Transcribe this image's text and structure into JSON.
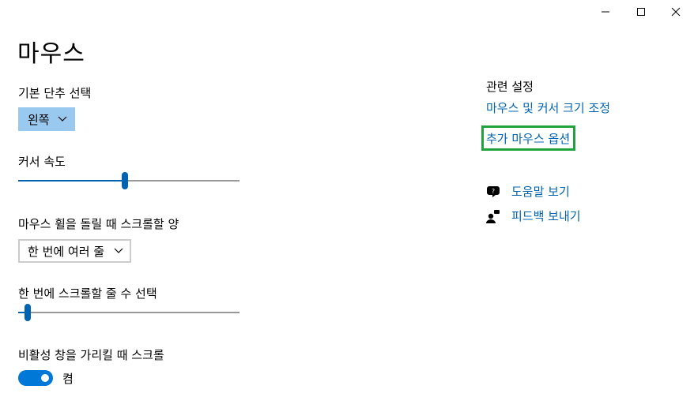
{
  "window": {
    "minimize_icon": "minimize-icon",
    "maximize_icon": "maximize-icon",
    "close_icon": "close-icon"
  },
  "page": {
    "title": "마우스"
  },
  "primary_button": {
    "label": "기본 단추 선택",
    "value": "왼쪽"
  },
  "cursor_speed": {
    "label": "커서 속도",
    "level": 0.48
  },
  "wheel_scroll": {
    "label": "마우스 휠을 돌릴 때 스크롤할 양",
    "value": "한 번에 여러 줄"
  },
  "lines_to_scroll": {
    "label": "한 번에 스크롤할 줄 수 선택",
    "level": 0.03
  },
  "inactive_scroll": {
    "label": "비활성 창을 가리킬 때 스크롤",
    "state": "켬",
    "on": true
  },
  "related": {
    "heading": "관련 설정",
    "links": [
      "마우스 및 커서 크기 조정",
      "추가 마우스 옵션"
    ]
  },
  "help": {
    "get_help": "도움말 보기",
    "feedback": "피드백 보내기"
  },
  "colors": {
    "accent": "#0063b1",
    "toggle_on": "#0078d7",
    "combo_selected_bg": "#99c9ef",
    "highlight_box": "#1fa33a"
  }
}
